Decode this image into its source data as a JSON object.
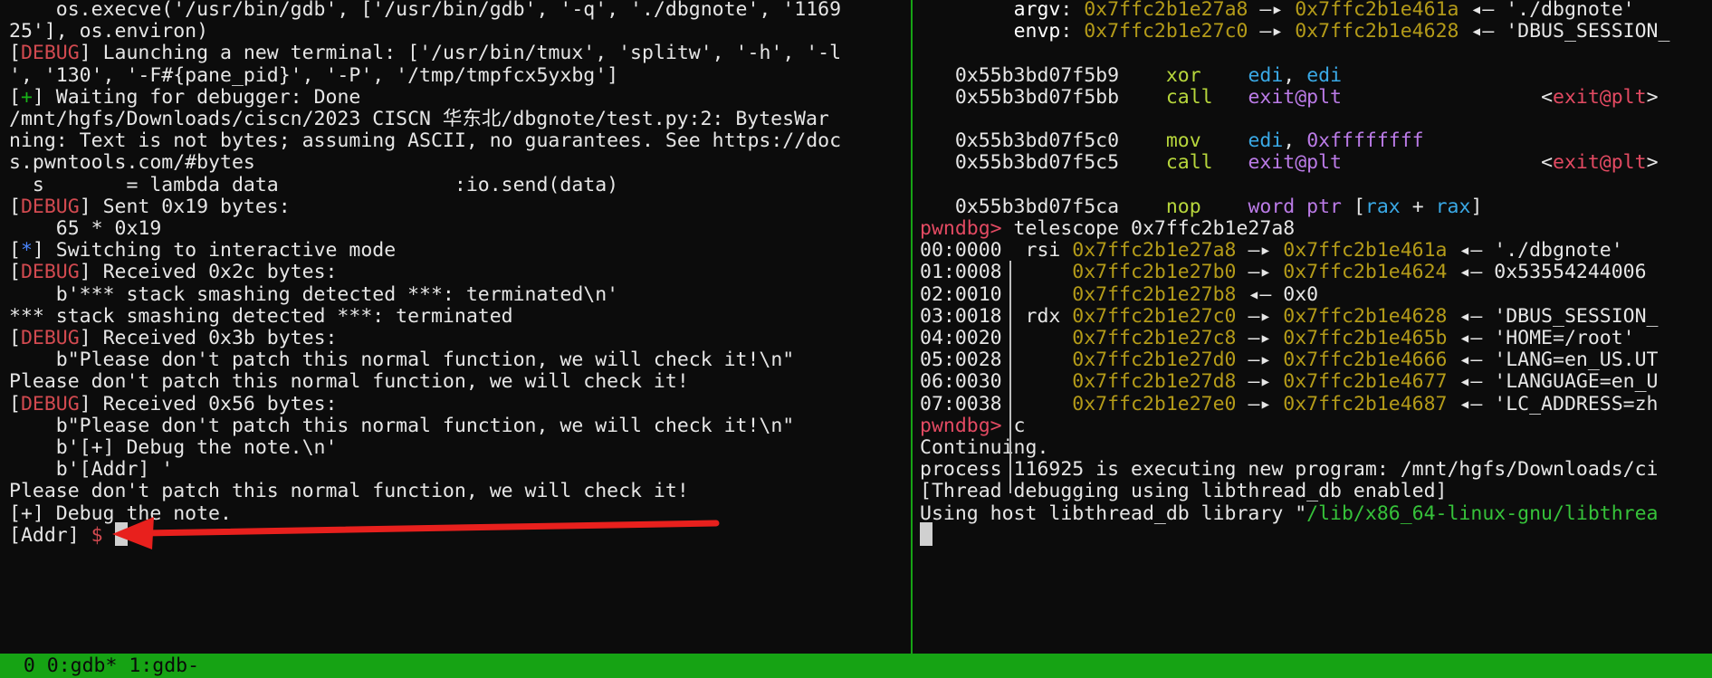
{
  "left_terminal": {
    "lines": [
      [
        {
          "t": "    os.execve('/usr/bin/gdb', ['/usr/bin/gdb', '-q', './dbgnote', '1169"
        }
      ],
      [
        {
          "t": "25'], os.environ)"
        }
      ],
      [
        {
          "t": "[",
          "c": ""
        },
        {
          "t": "DEBUG",
          "c": "red"
        },
        {
          "t": "] Launching a new terminal: ['/usr/bin/tmux', 'splitw', '-h', '-l"
        }
      ],
      [
        {
          "t": "', '130', '-F#{pane_pid}', '-P', '/tmp/tmpfcx5yxbg']"
        }
      ],
      [
        {
          "t": "["
        },
        {
          "t": "+",
          "c": "green"
        },
        {
          "t": "] Waiting for debugger: Done"
        }
      ],
      [
        {
          "t": "/mnt/hgfs/Downloads/ciscn/2023 CISCN 华东北/dbgnote/test.py:2: BytesWar"
        }
      ],
      [
        {
          "t": "ning: Text is not bytes; assuming ASCII, no guarantees. See https://doc"
        }
      ],
      [
        {
          "t": "s.pwntools.com/#bytes"
        }
      ],
      [
        {
          "t": "  s       = lambda data               :io.send(data)"
        }
      ],
      [
        {
          "t": "["
        },
        {
          "t": "DEBUG",
          "c": "red"
        },
        {
          "t": "] Sent 0x19 bytes:"
        }
      ],
      [
        {
          "t": "    65 * 0x19"
        }
      ],
      [
        {
          "t": "["
        },
        {
          "t": "*",
          "c": "blue"
        },
        {
          "t": "] Switching to interactive mode"
        }
      ],
      [
        {
          "t": "["
        },
        {
          "t": "DEBUG",
          "c": "red"
        },
        {
          "t": "] Received 0x2c bytes:"
        }
      ],
      [
        {
          "t": "    b'*** stack smashing detected ***: terminated\\n'"
        }
      ],
      [
        {
          "t": "*** stack smashing detected ***: terminated"
        }
      ],
      [
        {
          "t": "["
        },
        {
          "t": "DEBUG",
          "c": "red"
        },
        {
          "t": "] Received 0x3b bytes:"
        }
      ],
      [
        {
          "t": "    b\"Please don't patch this normal function, we will check it!\\n\""
        }
      ],
      [
        {
          "t": "Please don't patch this normal function, we will check it!"
        }
      ],
      [
        {
          "t": "["
        },
        {
          "t": "DEBUG",
          "c": "red"
        },
        {
          "t": "] Received 0x56 bytes:"
        }
      ],
      [
        {
          "t": "    b\"Please don't patch this normal function, we will check it!\\n\""
        }
      ],
      [
        {
          "t": "    b'[+] Debug the note.\\n'"
        }
      ],
      [
        {
          "t": "    b'[Addr] '"
        }
      ],
      [
        {
          "t": "Please don't patch this normal function, we will check it!"
        }
      ],
      [
        {
          "t": "[+] Debug the note."
        }
      ],
      [
        {
          "t": "[Addr] "
        },
        {
          "t": "$",
          "c": "red"
        },
        {
          "t": " "
        }
      ]
    ]
  },
  "right_terminal": {
    "lines": [
      [
        {
          "t": "        "
        },
        {
          "t": "argv",
          "c": "bright"
        },
        {
          "t": ": "
        },
        {
          "t": "0x7ffc2b1e27a8",
          "c": "yellow"
        },
        {
          "t": " —▸ "
        },
        {
          "t": "0x7ffc2b1e461a",
          "c": "yellow"
        },
        {
          "t": " ◂— './dbgnote'"
        }
      ],
      [
        {
          "t": "        "
        },
        {
          "t": "envp",
          "c": "bright"
        },
        {
          "t": ": "
        },
        {
          "t": "0x7ffc2b1e27c0",
          "c": "yellow"
        },
        {
          "t": " —▸ "
        },
        {
          "t": "0x7ffc2b1e4628",
          "c": "yellow"
        },
        {
          "t": " ◂— 'DBUS_SESSION_"
        }
      ],
      [
        {
          "t": ""
        }
      ],
      [
        {
          "t": "   0x55b3bd07f5b9    "
        },
        {
          "t": "xor",
          "c": "lime"
        },
        {
          "t": "    "
        },
        {
          "t": "edi",
          "c": "cyan"
        },
        {
          "t": ", "
        },
        {
          "t": "edi",
          "c": "cyan"
        }
      ],
      [
        {
          "t": "   0x55b3bd07f5bb    "
        },
        {
          "t": "call",
          "c": "lime"
        },
        {
          "t": "   "
        },
        {
          "t": "exit@plt",
          "c": "purple"
        },
        {
          "t": "                 <"
        },
        {
          "t": "exit@plt",
          "c": "lred"
        },
        {
          "t": ">"
        }
      ],
      [
        {
          "t": ""
        }
      ],
      [
        {
          "t": "   0x55b3bd07f5c0    "
        },
        {
          "t": "mov",
          "c": "lime"
        },
        {
          "t": "    "
        },
        {
          "t": "edi",
          "c": "cyan"
        },
        {
          "t": ", "
        },
        {
          "t": "0xffffffff",
          "c": "purple"
        }
      ],
      [
        {
          "t": "   0x55b3bd07f5c5    "
        },
        {
          "t": "call",
          "c": "lime"
        },
        {
          "t": "   "
        },
        {
          "t": "exit@plt",
          "c": "purple"
        },
        {
          "t": "                 <"
        },
        {
          "t": "exit@plt",
          "c": "lred"
        },
        {
          "t": ">"
        }
      ],
      [
        {
          "t": ""
        }
      ],
      [
        {
          "t": "   0x55b3bd07f5ca    "
        },
        {
          "t": "nop",
          "c": "lime"
        },
        {
          "t": "    "
        },
        {
          "t": "word ptr",
          "c": "purple"
        },
        {
          "t": " ["
        },
        {
          "t": "rax",
          "c": "cyan"
        },
        {
          "t": " + "
        },
        {
          "t": "rax",
          "c": "cyan"
        },
        {
          "t": "]"
        }
      ],
      [
        {
          "t": "pwndbg>",
          "c": "lred"
        },
        {
          "t": " telescope 0x7ffc2b1e27a8"
        }
      ],
      [
        {
          "t": "00:0000  rsi "
        },
        {
          "t": "0x7ffc2b1e27a8",
          "c": "yellow"
        },
        {
          "t": " —▸ "
        },
        {
          "t": "0x7ffc2b1e461a",
          "c": "yellow"
        },
        {
          "t": " ◂— './dbgnote'"
        }
      ],
      [
        {
          "t": "01:0008      "
        },
        {
          "t": "0x7ffc2b1e27b0",
          "c": "yellow"
        },
        {
          "t": " —▸ "
        },
        {
          "t": "0x7ffc2b1e4624",
          "c": "yellow"
        },
        {
          "t": " ◂— 0x53554244006"
        }
      ],
      [
        {
          "t": "02:0010      "
        },
        {
          "t": "0x7ffc2b1e27b8",
          "c": "yellow"
        },
        {
          "t": " ◂— 0x0"
        }
      ],
      [
        {
          "t": "03:0018  rdx "
        },
        {
          "t": "0x7ffc2b1e27c0",
          "c": "yellow"
        },
        {
          "t": " —▸ "
        },
        {
          "t": "0x7ffc2b1e4628",
          "c": "yellow"
        },
        {
          "t": " ◂— 'DBUS_SESSION_"
        }
      ],
      [
        {
          "t": "04:0020      "
        },
        {
          "t": "0x7ffc2b1e27c8",
          "c": "yellow"
        },
        {
          "t": " —▸ "
        },
        {
          "t": "0x7ffc2b1e465b",
          "c": "yellow"
        },
        {
          "t": " ◂— 'HOME=/root'"
        }
      ],
      [
        {
          "t": "05:0028      "
        },
        {
          "t": "0x7ffc2b1e27d0",
          "c": "yellow"
        },
        {
          "t": " —▸ "
        },
        {
          "t": "0x7ffc2b1e4666",
          "c": "yellow"
        },
        {
          "t": " ◂— 'LANG=en_US.UT"
        }
      ],
      [
        {
          "t": "06:0030      "
        },
        {
          "t": "0x7ffc2b1e27d8",
          "c": "yellow"
        },
        {
          "t": " —▸ "
        },
        {
          "t": "0x7ffc2b1e4677",
          "c": "yellow"
        },
        {
          "t": " ◂— 'LANGUAGE=en_U"
        }
      ],
      [
        {
          "t": "07:0038      "
        },
        {
          "t": "0x7ffc2b1e27e0",
          "c": "yellow"
        },
        {
          "t": " —▸ "
        },
        {
          "t": "0x7ffc2b1e4687",
          "c": "yellow"
        },
        {
          "t": " ◂— 'LC_ADDRESS=zh"
        }
      ],
      [
        {
          "t": "pwndbg>",
          "c": "lred"
        },
        {
          "t": " c"
        }
      ],
      [
        {
          "t": "Continuing."
        }
      ],
      [
        {
          "t": "process 116925 is executing new program: /mnt/hgfs/Downloads/ci"
        }
      ],
      [
        {
          "t": "[Thread debugging using libthread_db enabled]"
        }
      ],
      [
        {
          "t": "Using host libthread_db library \""
        },
        {
          "t": "/lib/x86_64-linux-gnu/libthrea",
          "c": "sgreen"
        }
      ],
      [
        {
          "t": ""
        }
      ]
    ]
  },
  "status_bar": {
    "text": "  0 0:gdb* 1:gdb-"
  },
  "colors": {
    "background": "#0c0c0c",
    "tmux_green": "#16a314",
    "debug_red": "#d24a50",
    "address_yellow": "#b49b19",
    "annotation_arrow": "#e8201d"
  }
}
